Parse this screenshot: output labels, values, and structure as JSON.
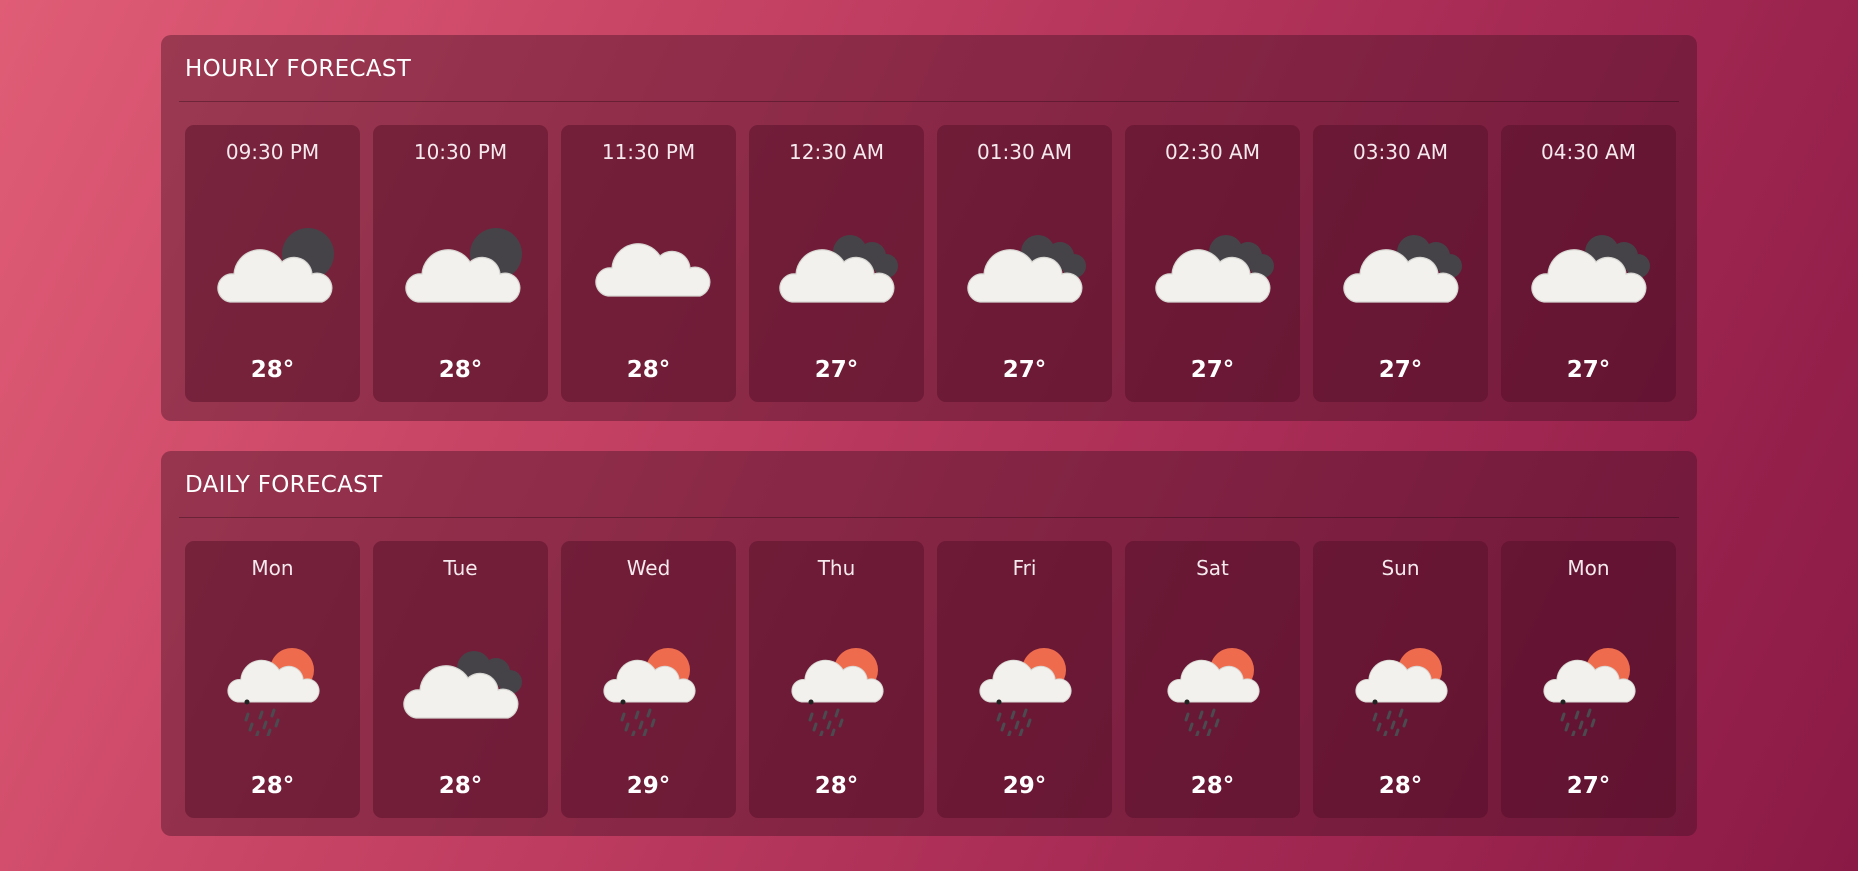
{
  "hourly": {
    "title": "HOURLY FORECAST",
    "items": [
      {
        "time": "09:30 PM",
        "temp": "28°",
        "icon": "cloud-moon-icon"
      },
      {
        "time": "10:30 PM",
        "temp": "28°",
        "icon": "cloud-moon-icon"
      },
      {
        "time": "11:30 PM",
        "temp": "28°",
        "icon": "cloud-icon"
      },
      {
        "time": "12:30 AM",
        "temp": "27°",
        "icon": "cloud-dark-clouds-icon"
      },
      {
        "time": "01:30 AM",
        "temp": "27°",
        "icon": "cloud-dark-clouds-icon"
      },
      {
        "time": "02:30 AM",
        "temp": "27°",
        "icon": "cloud-dark-clouds-icon"
      },
      {
        "time": "03:30 AM",
        "temp": "27°",
        "icon": "cloud-dark-clouds-icon"
      },
      {
        "time": "04:30 AM",
        "temp": "27°",
        "icon": "cloud-dark-clouds-icon"
      }
    ]
  },
  "daily": {
    "title": "DAILY FORECAST",
    "items": [
      {
        "day": "Mon",
        "temp": "28°",
        "icon": "sun-cloud-rain-icon"
      },
      {
        "day": "Tue",
        "temp": "28°",
        "icon": "cloud-dark-clouds-icon"
      },
      {
        "day": "Wed",
        "temp": "29°",
        "icon": "sun-cloud-rain-icon"
      },
      {
        "day": "Thu",
        "temp": "28°",
        "icon": "sun-cloud-rain-icon"
      },
      {
        "day": "Fri",
        "temp": "29°",
        "icon": "sun-cloud-rain-icon"
      },
      {
        "day": "Sat",
        "temp": "28°",
        "icon": "sun-cloud-rain-icon"
      },
      {
        "day": "Sun",
        "temp": "28°",
        "icon": "sun-cloud-rain-icon"
      },
      {
        "day": "Mon",
        "temp": "27°",
        "icon": "sun-cloud-rain-icon"
      }
    ]
  },
  "colors": {
    "cloud": "#f2f1ee",
    "dark": "#454348",
    "sun": "#ee6c4d",
    "rain": "#4a4a4f"
  }
}
